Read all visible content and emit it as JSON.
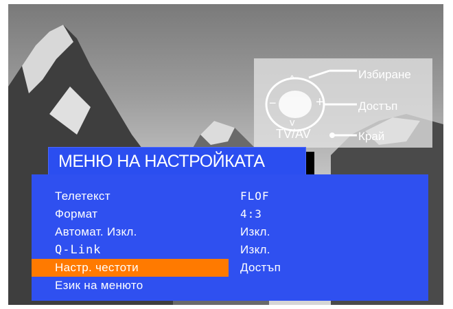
{
  "menu": {
    "title": "МЕНЮ НА НАСТРОЙКАТА",
    "rows": [
      {
        "label": "Телетекст",
        "value": "FLOF",
        "selected": false
      },
      {
        "label": "Формат",
        "value": "4:3",
        "selected": false
      },
      {
        "label": "Автомат. Изкл.",
        "value": "Изкл.",
        "selected": false
      },
      {
        "label": "Q-Link",
        "value": "Изкл.",
        "selected": false
      },
      {
        "label": "Настр. честоти",
        "value": "Достъп",
        "selected": true
      },
      {
        "label": "Език на менюто",
        "value": "",
        "selected": false
      }
    ]
  },
  "guide": {
    "select_label": "Избиране",
    "access_label": "Достъп",
    "exit_label": "Край",
    "tvav_label": "TV/AV",
    "up_symbol": "^",
    "down_symbol": "v",
    "minus_symbol": "−",
    "plus_symbol": "+"
  },
  "colors": {
    "menu_blue": "#2f50f0",
    "highlight_orange": "#ff7a00",
    "text_white": "#ffffff"
  }
}
